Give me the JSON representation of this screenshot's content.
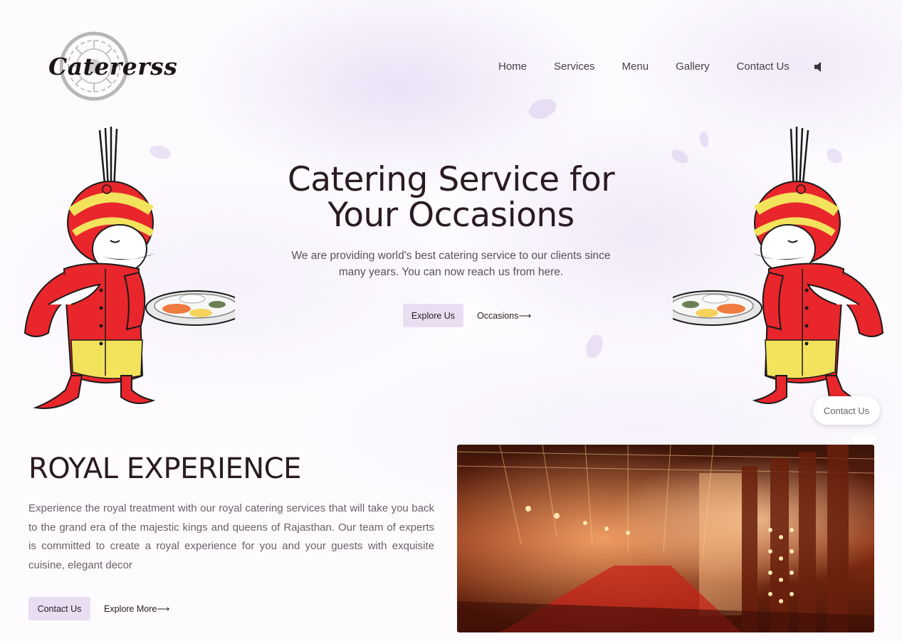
{
  "brand": {
    "name": "Catererss"
  },
  "nav": {
    "items": [
      "Home",
      "Services",
      "Menu",
      "Gallery",
      "Contact Us"
    ],
    "sound_icon": "speaker-icon"
  },
  "hero": {
    "title_line1": "Catering Service for",
    "title_line2": "Your Occasions",
    "subtitle_line1": "We are providing world's best catering service to our clients since",
    "subtitle_line2": "many years. You can now reach us from here.",
    "explore_label": "Explore Us",
    "occasions_label": "Occasions⟶"
  },
  "floating_contact": {
    "label": "Contact Us"
  },
  "royal": {
    "title": "ROYAL EXPERIENCE",
    "text": "Experience the royal treatment with our royal catering services that will take you back to the grand era of the majestic kings and queens of Rajasthan. Our team of experts is committed to create a royal experience for you and your guests with exquisite cuisine, elegant decor",
    "contact_label": "Contact Us",
    "explore_label": "Explore More⟶"
  },
  "colors": {
    "accent_button_bg": "#e9def1",
    "text_dark": "#2a1b22",
    "mascot_red": "#e8262b",
    "mascot_yellow": "#f3e25c"
  }
}
